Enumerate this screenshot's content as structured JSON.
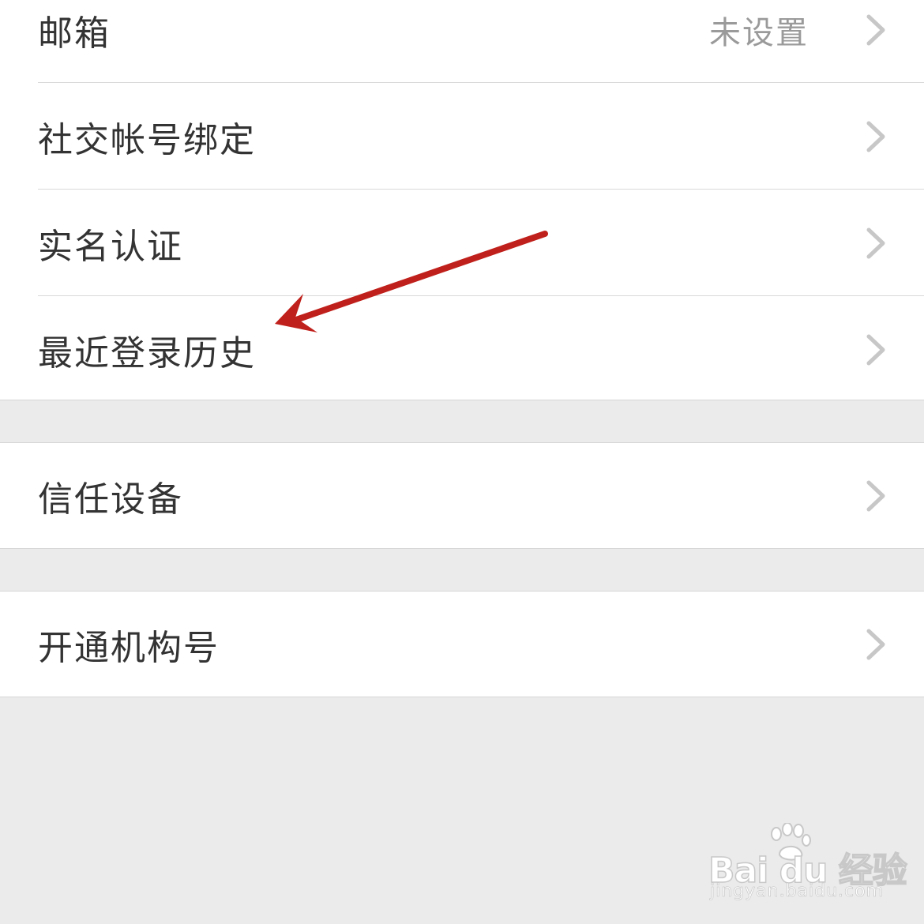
{
  "settings": {
    "groups": [
      {
        "items": [
          {
            "label": "邮箱",
            "value": "未设置"
          },
          {
            "label": "社交帐号绑定",
            "value": ""
          },
          {
            "label": "实名认证",
            "value": ""
          },
          {
            "label": "最近登录历史",
            "value": ""
          }
        ]
      },
      {
        "items": [
          {
            "label": "信任设备",
            "value": ""
          }
        ]
      },
      {
        "items": [
          {
            "label": "开通机构号",
            "value": ""
          }
        ]
      }
    ]
  },
  "annotation": {
    "arrow_color": "#c0201b",
    "points_to": "最近登录历史"
  },
  "watermark": {
    "brand": "Bai du 经验",
    "url": "jingyan.baidu.com"
  },
  "colors": {
    "background": "#ebebeb",
    "row_background": "#ffffff",
    "label_text": "#333333",
    "value_text": "#9a9a9a",
    "chevron": "#c7c7c7",
    "divider": "#d9d9d9"
  }
}
